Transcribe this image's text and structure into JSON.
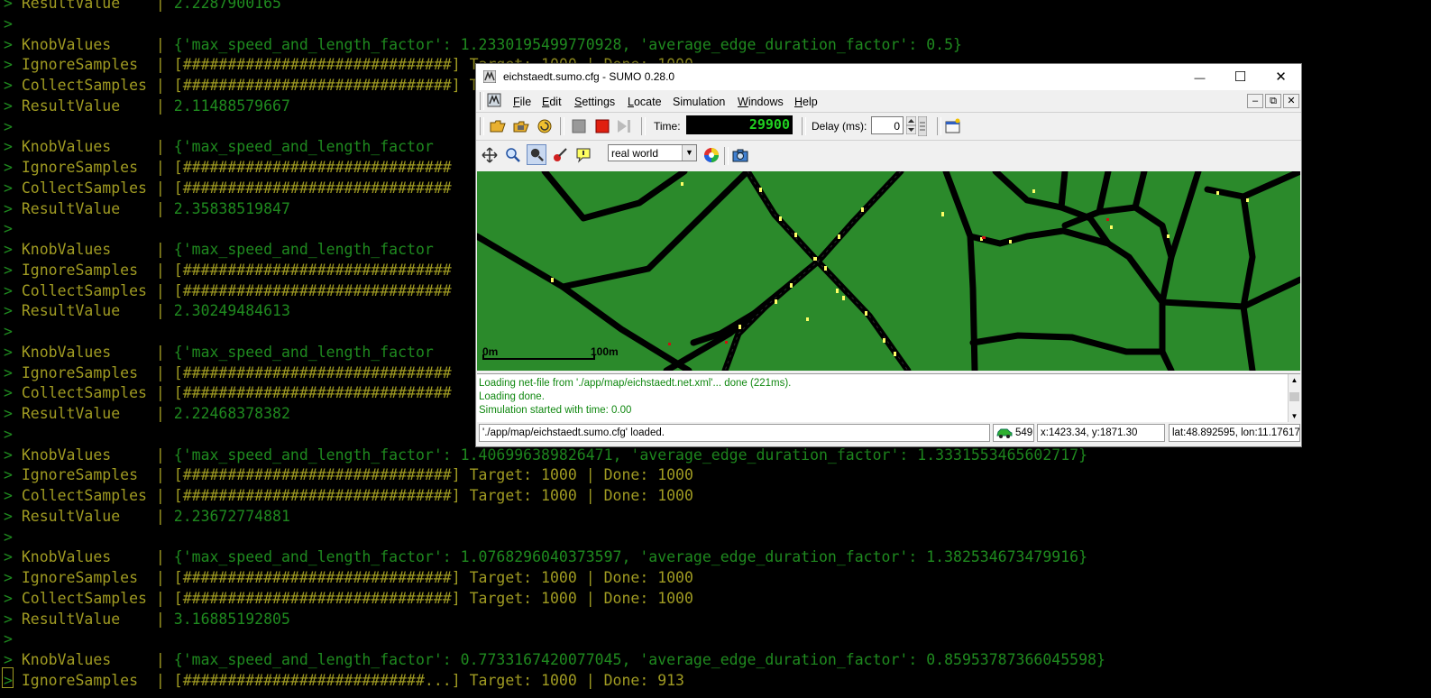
{
  "terminal": {
    "lines": [
      {
        "prompt": ">",
        "key": "ResultValue   ",
        "value": "2.2287900165",
        "kind": "result"
      },
      {
        "prompt": ">",
        "key": "",
        "value": "",
        "kind": "blank"
      },
      {
        "prompt": ">",
        "key": "KnobValues    ",
        "value": "{'max_speed_and_length_factor': 1.2330195499770928, 'average_edge_duration_factor': 0.5}",
        "kind": "knob"
      },
      {
        "prompt": ">",
        "key": "IgnoreSamples ",
        "value": "[##############################] Target: 1000 | Done: 1000",
        "kind": "bar"
      },
      {
        "prompt": ">",
        "key": "CollectSamples",
        "value": "[##############################] Target: 1000 | Done: 1000",
        "kind": "bar"
      },
      {
        "prompt": ">",
        "key": "ResultValue   ",
        "value": "2.11488579667",
        "kind": "result"
      },
      {
        "prompt": ">",
        "key": "",
        "value": "",
        "kind": "blank"
      },
      {
        "prompt": ">",
        "key": "KnobValues    ",
        "value": "{'max_speed_and_length_factor",
        "kind": "knob"
      },
      {
        "prompt": ">",
        "key": "IgnoreSamples ",
        "value": "[##############################",
        "kind": "bar"
      },
      {
        "prompt": ">",
        "key": "CollectSamples",
        "value": "[##############################",
        "kind": "bar"
      },
      {
        "prompt": ">",
        "key": "ResultValue   ",
        "value": "2.35838519847",
        "kind": "result"
      },
      {
        "prompt": ">",
        "key": "",
        "value": "",
        "kind": "blank"
      },
      {
        "prompt": ">",
        "key": "KnobValues    ",
        "value": "{'max_speed_and_length_factor",
        "kind": "knob"
      },
      {
        "prompt": ">",
        "key": "IgnoreSamples ",
        "value": "[##############################",
        "kind": "bar"
      },
      {
        "prompt": ">",
        "key": "CollectSamples",
        "value": "[##############################",
        "kind": "bar"
      },
      {
        "prompt": ">",
        "key": "ResultValue   ",
        "value": "2.30249484613",
        "kind": "result"
      },
      {
        "prompt": ">",
        "key": "",
        "value": "",
        "kind": "blank"
      },
      {
        "prompt": ">",
        "key": "KnobValues    ",
        "value": "{'max_speed_and_length_factor",
        "kind": "knob"
      },
      {
        "prompt": ">",
        "key": "IgnoreSamples ",
        "value": "[##############################",
        "kind": "bar"
      },
      {
        "prompt": ">",
        "key": "CollectSamples",
        "value": "[##############################",
        "kind": "bar"
      },
      {
        "prompt": ">",
        "key": "ResultValue   ",
        "value": "2.22468378382",
        "kind": "result"
      },
      {
        "prompt": ">",
        "key": "",
        "value": "",
        "kind": "blank"
      },
      {
        "prompt": ">",
        "key": "KnobValues    ",
        "value": "{'max_speed_and_length_factor': 1.4069963898264​71, 'average_edge_duration_factor': 1.3331553465602717}",
        "kind": "knob"
      },
      {
        "prompt": ">",
        "key": "IgnoreSamples ",
        "value": "[##############################] Target: 1000 | Done: 1000",
        "kind": "bar"
      },
      {
        "prompt": ">",
        "key": "CollectSamples",
        "value": "[##############################] Target: 1000 | Done: 1000",
        "kind": "bar"
      },
      {
        "prompt": ">",
        "key": "ResultValue   ",
        "value": "2.23672774881",
        "kind": "result"
      },
      {
        "prompt": ">",
        "key": "",
        "value": "",
        "kind": "blank"
      },
      {
        "prompt": ">",
        "key": "KnobValues    ",
        "value": "{'max_speed_and_length_factor': 1.0768296040373597, 'average_edge_duration_factor': 1.382534673479916}",
        "kind": "knob"
      },
      {
        "prompt": ">",
        "key": "IgnoreSamples ",
        "value": "[##############################] Target: 1000 | Done: 1000",
        "kind": "bar"
      },
      {
        "prompt": ">",
        "key": "CollectSamples",
        "value": "[##############################] Target: 1000 | Done: 1000",
        "kind": "bar"
      },
      {
        "prompt": ">",
        "key": "ResultValue   ",
        "value": "3.16885192805",
        "kind": "result"
      },
      {
        "prompt": ">",
        "key": "",
        "value": "",
        "kind": "blank"
      },
      {
        "prompt": ">",
        "key": "KnobValues    ",
        "value": "{'max_speed_and_length_factor': 0.7733167420077045, 'average_edge_duration_factor': 0.8595378736604559​8}",
        "kind": "knob"
      },
      {
        "prompt": ">",
        "key": "IgnoreSamples ",
        "value": "[###########################...] Target: 1000 | Done: 913",
        "kind": "bar"
      }
    ]
  },
  "sumo": {
    "title": "eichstaedt.sumo.cfg - SUMO 0.28.0",
    "window_controls": {
      "minimize": "—",
      "maximize": "☐",
      "close": "✕"
    },
    "menu": [
      {
        "label": "File",
        "u": "F",
        "rest": "ile"
      },
      {
        "label": "Edit",
        "u": "E",
        "rest": "dit"
      },
      {
        "label": "Settings",
        "u": "S",
        "rest": "ettings"
      },
      {
        "label": "Locate",
        "u": "L",
        "rest": "ocate"
      },
      {
        "label": "Simulation",
        "u": "",
        "rest": "Simulation"
      },
      {
        "label": "Windows",
        "u": "W",
        "rest": "indows"
      },
      {
        "label": "Help",
        "u": "H",
        "rest": "elp"
      }
    ],
    "toolbar": {
      "time_label": "Time:",
      "time_value": "29900",
      "delay_label": "Delay (ms):",
      "delay_value": "0"
    },
    "view": {
      "scheme": "real world"
    },
    "map": {
      "scale_start": "0m",
      "scale_end": "100m",
      "colors": {
        "grass": "#2b8a2b",
        "road": "#000000",
        "vehicle": "#ffff66"
      }
    },
    "log": [
      "Loading net-file from './app/map/eichstaedt.net.xml'... done (221ms).",
      "Loading done.",
      "Simulation started with time: 0.00"
    ],
    "status": {
      "message": "'./app/map/eichstaedt.sumo.cfg' loaded.",
      "vehicle_count": "549",
      "coords": "x:1423.34, y:1871.30",
      "geo": "lat:48.892595, lon:11.176172"
    }
  }
}
